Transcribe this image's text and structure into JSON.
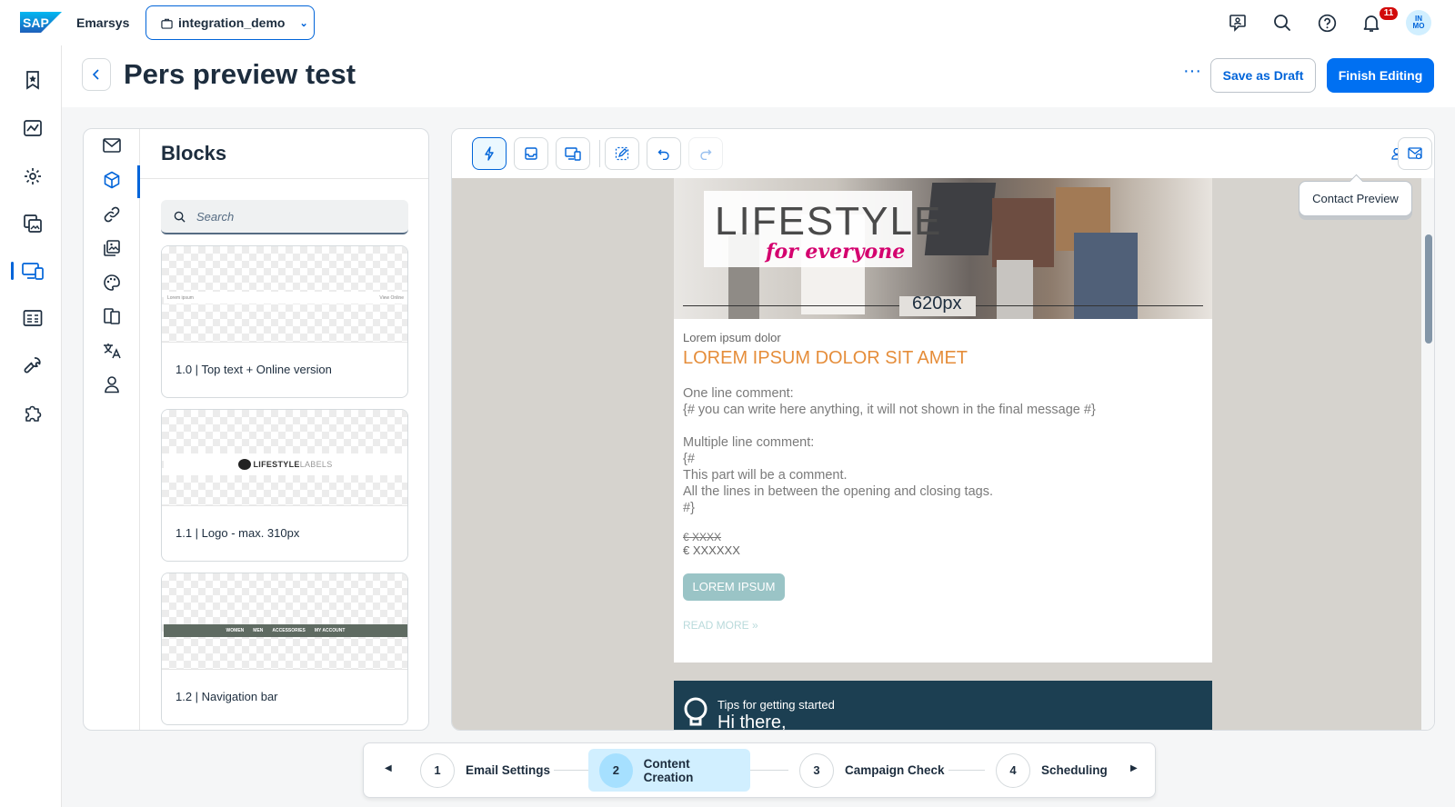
{
  "topbar": {
    "app_name": "Emarsys",
    "workspace": "integration_demo",
    "notification_count": "11",
    "avatar_line1": "IN",
    "avatar_line2": "MO"
  },
  "page": {
    "title": "Pers preview test",
    "more_label": "···",
    "save_draft_label": "Save as Draft",
    "finish_label": "Finish Editing"
  },
  "blocks": {
    "title": "Blocks",
    "search_placeholder": "Search",
    "items": [
      {
        "label": "1.0 | Top text + Online version",
        "thumb_left": "Lorem ipsum",
        "thumb_right": "View Online"
      },
      {
        "label": "1.1 | Logo - max. 310px",
        "thumb_text_a": "LIFESTYLE",
        "thumb_text_b": "LABELS"
      },
      {
        "label": "1.2 | Navigation bar",
        "nav": [
          "WOMEN",
          "MEN",
          "ACCESSORIES",
          "MY ACCOUNT"
        ]
      }
    ]
  },
  "editor": {
    "tooltip": "Contact Preview",
    "hero_word": "LIFESTYLE",
    "hero_sub": "for everyone",
    "width_label": "620px",
    "pre_heading": "Lorem ipsum dolor",
    "heading": "LOREM IPSUM DOLOR SIT AMET",
    "one_line_title": "One line comment:",
    "one_line_body": "{# you can write here anything, it will not shown in the final message #}",
    "multi_title": "Multiple line comment:",
    "multi_open": "{#",
    "multi_line1": "This part will be a comment.",
    "multi_line2": "All the lines in between the opening and closing tags.",
    "multi_close": "#}",
    "old_price": "€ XXXX",
    "price": "€ XXXXXX",
    "cta": "LOREM IPSUM",
    "read_more": "READ MORE »",
    "tips_small": "Tips for getting started",
    "tips_big": "Hi there,"
  },
  "wizard": {
    "steps": [
      {
        "num": "1",
        "label": "Email Settings"
      },
      {
        "num": "2",
        "label": "Content Creation"
      },
      {
        "num": "3",
        "label": "Campaign Check"
      },
      {
        "num": "4",
        "label": "Scheduling"
      }
    ],
    "active_step": 2
  },
  "colors": {
    "accent": "#0070f2",
    "brand_blue": "#0064d9",
    "heading_orange": "#e58d3a",
    "lifestyle_pink": "#d4006e",
    "notification_red": "#d20a0a"
  }
}
